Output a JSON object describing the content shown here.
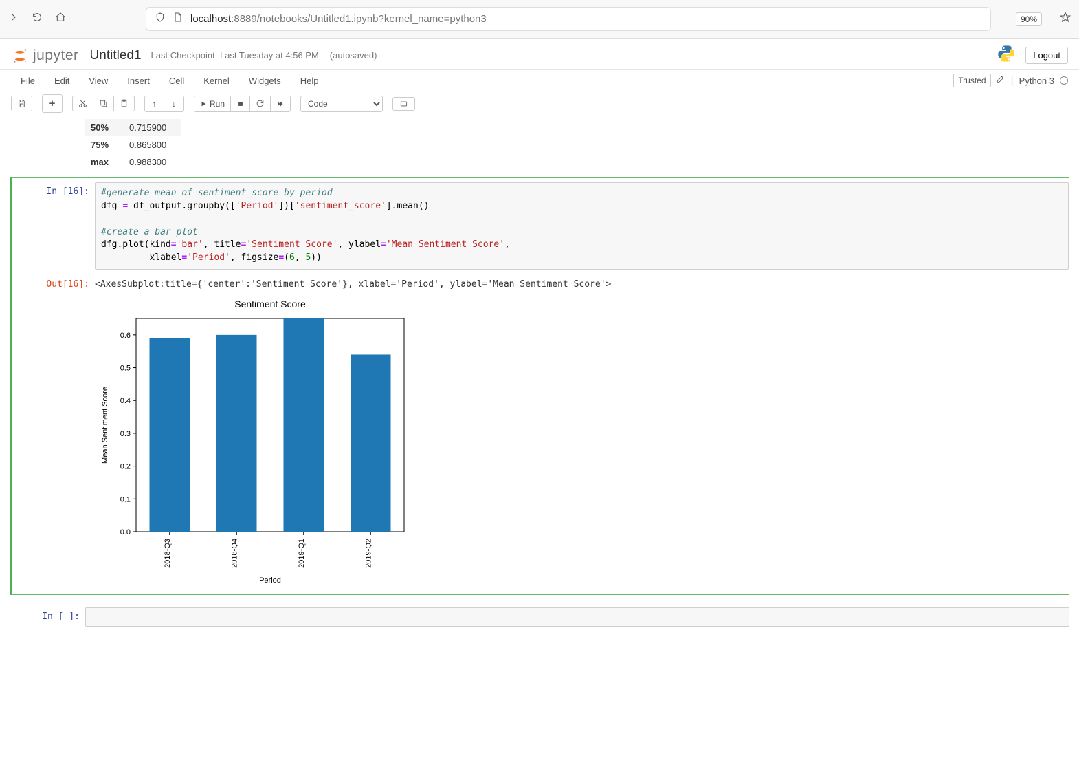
{
  "browser": {
    "url_host": "localhost",
    "url_rest": ":8889/notebooks/Untitled1.ipynb?kernel_name=python3",
    "zoom": "90%"
  },
  "header": {
    "brand": "jupyter",
    "notebook_name": "Untitled1",
    "checkpoint": "Last Checkpoint: Last Tuesday at 4:56 PM",
    "autosaved": "(autosaved)",
    "logout": "Logout"
  },
  "menubar": {
    "items": [
      "File",
      "Edit",
      "View",
      "Insert",
      "Cell",
      "Kernel",
      "Widgets",
      "Help"
    ],
    "trusted": "Trusted",
    "kernel": "Python 3"
  },
  "toolbar": {
    "run": "Run",
    "celltype": "Code"
  },
  "stats": {
    "rows": [
      {
        "label": "50%",
        "value": "0.715900"
      },
      {
        "label": "75%",
        "value": "0.865800"
      },
      {
        "label": "max",
        "value": "0.988300"
      }
    ]
  },
  "code_cell": {
    "in_prompt": "In [16]:",
    "out_prompt": "Out[16]:",
    "line1_comment": "#generate mean of sentiment_score by period",
    "line2a": "dfg ",
    "line2b": " df_output.groupby([",
    "line2_str1": "'Period'",
    "line2c": "])[",
    "line2_str2": "'sentiment_score'",
    "line2d": "].mean()",
    "line3": "",
    "line4_comment": "#create a bar plot",
    "line5a": "dfg.plot(kind",
    "line5_str1": "'bar'",
    "line5b": ", title",
    "line5_str2": "'Sentiment Score'",
    "line5c": ", ylabel",
    "line5_str3": "'Mean Sentiment Score'",
    "line5d": ",",
    "line6a": "         xlabel",
    "line6_str1": "'Period'",
    "line6b": ", figsize",
    "line6c": "(",
    "line6_num1": "6",
    "line6d": ", ",
    "line6_num2": "5",
    "line6e": "))",
    "output_text": "<AxesSubplot:title={'center':'Sentiment Score'}, xlabel='Period', ylabel='Mean Sentiment Score'>"
  },
  "empty_cell": {
    "prompt": "In [ ]:"
  },
  "chart_data": {
    "type": "bar",
    "title": "Sentiment Score",
    "xlabel": "Period",
    "ylabel": "Mean Sentiment Score",
    "categories": [
      "2018-Q3",
      "2018-Q4",
      "2019-Q1",
      "2019-Q2"
    ],
    "values": [
      0.59,
      0.6,
      0.65,
      0.54
    ],
    "ylim": [
      0.0,
      0.65
    ],
    "yticks": [
      0.0,
      0.1,
      0.2,
      0.3,
      0.4,
      0.5,
      0.6
    ],
    "bar_color": "#1f77b4"
  }
}
